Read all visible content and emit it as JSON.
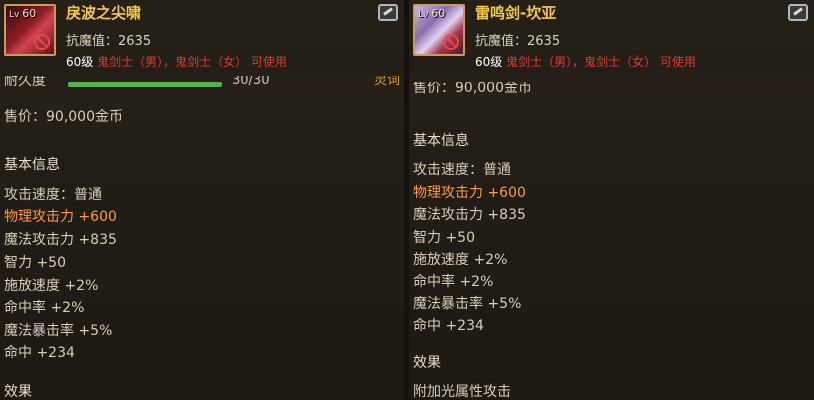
{
  "left": {
    "icon_level": "60",
    "level_prefix": "Lv",
    "name": "戾波之尖啸",
    "resistance": "抗魔值：2635",
    "requirement_level": "60级",
    "requirement_classes": "鬼剑士（男），鬼剑士（女） 可使用",
    "durability_label": "耐久度",
    "durability_value": "30/30",
    "durability_fraction": 1.0,
    "durability_tag": "灵词",
    "price": "售价：90,000金币",
    "section_basic": "基本信息",
    "stats": [
      "攻击速度：普通",
      "物理攻击力 +600",
      "魔法攻击力 +835",
      "智力 +50",
      "施放速度 +2%",
      "命中率 +2%",
      "魔法暴击率 +5%",
      "命中 +234"
    ],
    "section_effect": "效果"
  },
  "right": {
    "icon_level": "60",
    "level_prefix": "Lv",
    "name": "雷鸣剑-坎亚",
    "resistance": "抗魔值：2635",
    "requirement_level": "60级",
    "requirement_classes": "鬼剑士（男），鬼剑士（女） 可使用",
    "price": "售价：90,000金币",
    "section_basic": "基本信息",
    "stats": [
      "攻击速度：普通",
      "物理攻击力 +600",
      "魔法攻击力 +835",
      "智力 +50",
      "施放速度 +2%",
      "命中率 +2%",
      "魔法暴击率 +5%",
      "命中 +234"
    ],
    "section_effect": "效果",
    "effect_text": "附加光属性攻击"
  },
  "colors": {
    "title": "#f6c84a",
    "physical_attack": "#ff9a3c",
    "class_requirement": "#e23a32"
  }
}
